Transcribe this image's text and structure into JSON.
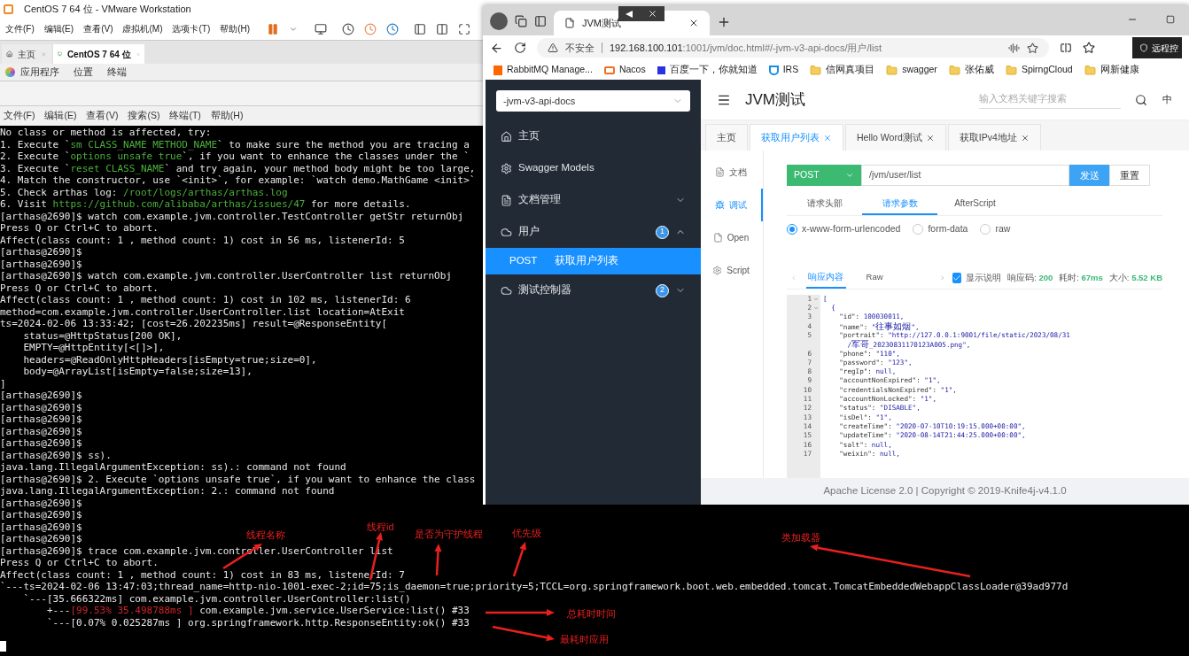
{
  "vmware": {
    "title": "CentOS 7 64 位 - VMware Workstation",
    "menu": [
      "文件(F)",
      "编辑(E)",
      "查看(V)",
      "虚拟机(M)",
      "选项卡(T)",
      "帮助(H)"
    ],
    "tabs": [
      {
        "label": "主页",
        "selected": false
      },
      {
        "label": "CentOS 7 64 位",
        "selected": true
      }
    ]
  },
  "gnome_bar": {
    "items": [
      "应用程序",
      "位置",
      "终端"
    ]
  },
  "terminal": {
    "menu": [
      "文件(F)",
      "编辑(E)",
      "查看(V)",
      "搜索(S)",
      "终端(T)",
      "帮助(H)"
    ],
    "lines": [
      [
        {
          "text": "No class or method is affected, try:",
          "kind": "normal"
        }
      ],
      [
        {
          "text": "1. Execute `",
          "kind": "normal"
        },
        {
          "text": "sm CLASS_NAME METHOD_NAME",
          "kind": "green"
        },
        {
          "text": "` to make sure the method you are tracing a",
          "kind": "normal"
        }
      ],
      [
        {
          "text": "2. Execute `",
          "kind": "normal"
        },
        {
          "text": "options unsafe true",
          "kind": "green"
        },
        {
          "text": "`, if you want to enhance the classes under the `",
          "kind": "normal"
        }
      ],
      [
        {
          "text": "3. Execute `",
          "kind": "normal"
        },
        {
          "text": "reset CLASS_NAME",
          "kind": "green"
        },
        {
          "text": "` and try again, your method body might be too large,",
          "kind": "normal"
        }
      ],
      [
        {
          "text": "4. Match the constructor, use `<init>`, for example: `watch demo.MathGame <init>`",
          "kind": "normal"
        }
      ],
      [
        {
          "text": "5. Check arthas log: ",
          "kind": "normal"
        },
        {
          "text": "/root/logs/arthas/arthas.log",
          "kind": "green"
        }
      ],
      [
        {
          "text": "6. Visit ",
          "kind": "normal"
        },
        {
          "text": "https://github.com/alibaba/arthas/issues/47",
          "kind": "green"
        },
        {
          "text": " for more details.",
          "kind": "normal"
        }
      ],
      [
        {
          "text": "[arthas@2690]$ watch com.example.jvm.controller.TestController getStr returnObj",
          "kind": "normal"
        }
      ],
      [
        {
          "text": "Press Q or Ctrl+C to abort.",
          "kind": "normal"
        }
      ],
      [
        {
          "text": "Affect(class count: 1 , method count: 1) cost in 56 ms, listenerId: 5",
          "kind": "normal"
        }
      ],
      [
        {
          "text": "[arthas@2690]$",
          "kind": "normal"
        }
      ],
      [
        {
          "text": "[arthas@2690]$",
          "kind": "normal"
        }
      ],
      [
        {
          "text": "[arthas@2690]$ watch com.example.jvm.controller.UserController list returnObj",
          "kind": "normal"
        }
      ],
      [
        {
          "text": "Press Q or Ctrl+C to abort.",
          "kind": "normal"
        }
      ],
      [
        {
          "text": "Affect(class count: 1 , method count: 1) cost in 102 ms, listenerId: 6",
          "kind": "normal"
        }
      ],
      [
        {
          "text": "method=com.example.jvm.controller.UserController.list location=AtExit",
          "kind": "normal"
        }
      ],
      [
        {
          "text": "ts=2024-02-06 13:33:42; [cost=26.202235ms] result=@ResponseEntity[",
          "kind": "normal"
        }
      ],
      [
        {
          "text": "    status=@HttpStatus[200 OK],",
          "kind": "normal"
        }
      ],
      [
        {
          "text": "    EMPTY=@HttpEntity[<[]>],",
          "kind": "normal"
        }
      ],
      [
        {
          "text": "    headers=@ReadOnlyHttpHeaders[isEmpty=true;size=0],",
          "kind": "normal"
        }
      ],
      [
        {
          "text": "    body=@ArrayList[isEmpty=false;size=13],",
          "kind": "normal"
        }
      ],
      [
        {
          "text": "]",
          "kind": "normal"
        }
      ],
      [
        {
          "text": "[arthas@2690]$",
          "kind": "normal"
        }
      ],
      [
        {
          "text": "[arthas@2690]$",
          "kind": "normal"
        }
      ],
      [
        {
          "text": "[arthas@2690]$",
          "kind": "normal"
        }
      ],
      [
        {
          "text": "[arthas@2690]$",
          "kind": "normal"
        }
      ],
      [
        {
          "text": "[arthas@2690]$",
          "kind": "normal"
        }
      ],
      [
        {
          "text": "[arthas@2690]$ ss).",
          "kind": "normal"
        }
      ],
      [
        {
          "text": "java.lang.IllegalArgumentException: ss).: command not found",
          "kind": "normal"
        }
      ],
      [
        {
          "text": "[arthas@2690]$ 2. Execute `options unsafe true`, if you want to enhance the class",
          "kind": "normal"
        }
      ],
      [
        {
          "text": "java.lang.IllegalArgumentException: 2.: command not found",
          "kind": "normal"
        }
      ],
      [
        {
          "text": "[arthas@2690]$",
          "kind": "normal"
        }
      ],
      [
        {
          "text": "[arthas@2690]$",
          "kind": "normal"
        }
      ],
      [
        {
          "text": "[arthas@2690]$",
          "kind": "normal"
        }
      ],
      [
        {
          "text": "[arthas@2690]$",
          "kind": "normal"
        }
      ],
      [
        {
          "text": "[arthas@2690]$ trace com.example.jvm.controller.UserController list",
          "kind": "normal"
        }
      ],
      [
        {
          "text": "Press Q or Ctrl+C to abort.",
          "kind": "normal"
        }
      ],
      [
        {
          "text": "Affect(class count: 1 , method count: 1) cost in 83 ms, listenerId: 7",
          "kind": "normal"
        }
      ],
      [
        {
          "text": "`---ts=2024-02-06 13:47:03;thread_name=http-nio-1001-exec-2;id=75;is_daemon=true;priority=5;TCCL=org.springframework.boot.web.embedded.tomcat.TomcatEmbeddedWebappClassLoader@39ad977d",
          "kind": "normal"
        }
      ],
      [
        {
          "text": "    `---[35.666322ms] com.example.jvm.controller.UserController:list()",
          "kind": "normal"
        }
      ],
      [
        {
          "text": "        +---",
          "kind": "normal"
        },
        {
          "text": "[99.53% 35.498788ms ]",
          "kind": "red"
        },
        {
          "text": " com.example.jvm.service.UserService:list() #33",
          "kind": "normal"
        }
      ],
      [
        {
          "text": "        `---[0.07% 0.025287ms ] org.springframework.http.ResponseEntity:ok() #33",
          "kind": "normal"
        }
      ]
    ]
  },
  "annotations": [
    {
      "text": "线程名称"
    },
    {
      "text": "线程id"
    },
    {
      "text": "是否为守护线程"
    },
    {
      "text": "优先级"
    },
    {
      "text": "类加载器"
    },
    {
      "text": "总耗时时间"
    },
    {
      "text": "最耗时应用"
    }
  ],
  "browser": {
    "tab": {
      "title": "JVM测试"
    },
    "address": {
      "security": "不安全",
      "host": "192.168.100.101",
      "path": ":1001/jvm/doc.html#/-jvm-v3-api-docs/用户/list"
    },
    "remote_button": "远程控",
    "bookmarks": [
      {
        "label": "RabbitMQ Manage...",
        "kind": "rabbit"
      },
      {
        "label": "Nacos",
        "kind": "nacos"
      },
      {
        "label": "百度一下，你就知道",
        "kind": "baidu"
      },
      {
        "label": "IRS",
        "kind": "irs"
      },
      {
        "label": "信网真项目",
        "kind": "folder"
      },
      {
        "label": "swagger",
        "kind": "folder"
      },
      {
        "label": "张佑威",
        "kind": "folder"
      },
      {
        "label": "SpirngCloud",
        "kind": "folder"
      },
      {
        "label": "网新健康",
        "kind": "folder"
      }
    ],
    "docs": {
      "group": "-jvm-v3-api-docs",
      "nav": [
        {
          "label": "主页",
          "kind": "home"
        },
        {
          "label": "Swagger Models",
          "kind": "models"
        },
        {
          "label": "文档管理",
          "kind": "docs",
          "expanded": false
        },
        {
          "label": "用户",
          "kind": "group",
          "count": "1",
          "expanded": true,
          "children": [
            {
              "method": "POST",
              "label": "获取用户列表",
              "selected": true
            }
          ]
        },
        {
          "label": "测试控制器",
          "kind": "group",
          "count": "2",
          "expanded": false
        }
      ],
      "title": "JVM测试",
      "search": {
        "placeholder": "输入文档关键字搜索"
      },
      "language": "中",
      "tabs": [
        {
          "label": "主页",
          "closable": false,
          "selected": false
        },
        {
          "label": "获取用户列表",
          "closable": true,
          "selected": true
        },
        {
          "label": "Hello Word测试",
          "closable": true,
          "selected": false
        },
        {
          "label": "获取IPv4地址",
          "closable": true,
          "selected": false
        }
      ],
      "side_tabs": [
        {
          "label": "文档",
          "kind": "doc",
          "selected": false
        },
        {
          "label": "调试",
          "kind": "debug",
          "selected": true
        },
        {
          "label": "Open",
          "kind": "open",
          "selected": false
        },
        {
          "label": "Script",
          "kind": "script",
          "selected": false
        }
      ],
      "method": "POST",
      "path": "/jvm/user/list",
      "send": "发送",
      "reset": "重置",
      "request_tabs": [
        {
          "label": "请求头部",
          "selected": false
        },
        {
          "label": "请求参数",
          "selected": true
        },
        {
          "label": "AfterScript",
          "selected": false
        }
      ],
      "body_types": [
        {
          "label": "x-www-form-urlencoded",
          "selected": true
        },
        {
          "label": "form-data",
          "selected": false
        },
        {
          "label": "raw",
          "selected": false
        }
      ],
      "response_tabs": [
        {
          "label": "响应内容",
          "selected": true
        },
        {
          "label": "Raw",
          "selected": false
        }
      ],
      "show_description": {
        "label": "显示说明",
        "checked": true
      },
      "stats": [
        {
          "label": "响应码:",
          "value": "200"
        },
        {
          "label": "耗时:",
          "value": "67ms"
        },
        {
          "label": "大小:",
          "value": "5.52 KB"
        }
      ],
      "code": [
        {
          "number": "1",
          "fold": true,
          "text": "["
        },
        {
          "number": "2",
          "fold": true,
          "text": "  {"
        },
        {
          "number": "3",
          "text": "    \"id\": 100030011,"
        },
        {
          "number": "4",
          "text": "    \"name\": \"往事如烟\","
        },
        {
          "number": "5",
          "text": "    \"portrait\": \"http://127.0.0.1:9001/file/static/2023/08/31"
        },
        {
          "text": "      /军哥_20230831170123A005.png\","
        },
        {
          "number": "6",
          "text": "    \"phone\": \"110\","
        },
        {
          "number": "7",
          "text": "    \"password\": \"123\","
        },
        {
          "number": "8",
          "text": "    \"regIp\": null,"
        },
        {
          "number": "9",
          "text": "    \"accountNonExpired\": \"1\","
        },
        {
          "number": "10",
          "text": "    \"credentialsNonExpired\": \"1\","
        },
        {
          "number": "11",
          "text": "    \"accountNonLocked\": \"1\","
        },
        {
          "number": "12",
          "text": "    \"status\": \"DISABLE\","
        },
        {
          "number": "13",
          "text": "    \"isDel\": \"1\","
        },
        {
          "number": "14",
          "text": "    \"createTime\": \"2020-07-10T10:19:15.000+00:00\","
        },
        {
          "number": "15",
          "text": "    \"updateTime\": \"2020-08-14T21:44:25.000+00:00\","
        },
        {
          "number": "16",
          "text": "    \"salt\": null,"
        },
        {
          "number": "17",
          "text": "    \"weixin\": null,"
        }
      ],
      "footer": "Apache License 2.0 | Copyright © 2019-Knife4j-v4.1.0"
    }
  }
}
